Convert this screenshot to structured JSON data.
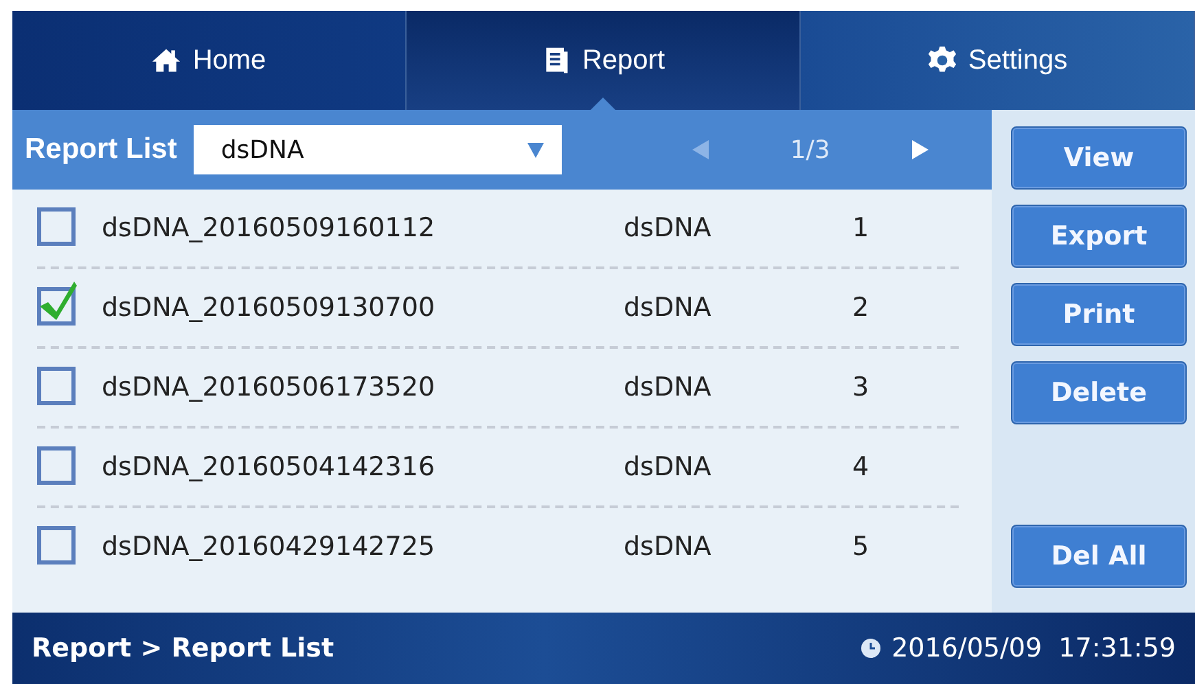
{
  "tabs": [
    {
      "kind": "home",
      "label": "Home",
      "selected": false
    },
    {
      "kind": "report",
      "label": "Report",
      "selected": true
    },
    {
      "kind": "settings",
      "label": "Settings",
      "selected": false
    }
  ],
  "list_header": {
    "title": "Report List",
    "filter": "dsDNA",
    "page": "1/3"
  },
  "rows": [
    {
      "name": "dsDNA_20160509160112",
      "type": "dsDNA",
      "number": "1",
      "checked": false
    },
    {
      "name": "dsDNA_20160509130700",
      "type": "dsDNA",
      "number": "2",
      "checked": true
    },
    {
      "name": "dsDNA_20160506173520",
      "type": "dsDNA",
      "number": "3",
      "checked": false
    },
    {
      "name": "dsDNA_20160504142316",
      "type": "dsDNA",
      "number": "4",
      "checked": false
    },
    {
      "name": "dsDNA_20160429142725",
      "type": "dsDNA",
      "number": "5",
      "checked": false
    }
  ],
  "buttons": [
    {
      "label": "View",
      "kind": "top"
    },
    {
      "label": "Export",
      "kind": "top"
    },
    {
      "label": "Print",
      "kind": "top"
    },
    {
      "label": "Delete",
      "kind": "top"
    },
    {
      "label": "Del All",
      "kind": "bottom"
    }
  ],
  "status_bar": {
    "breadcrumb": "Report > Report List",
    "datetime": "2016/05/09  17:31:59"
  }
}
